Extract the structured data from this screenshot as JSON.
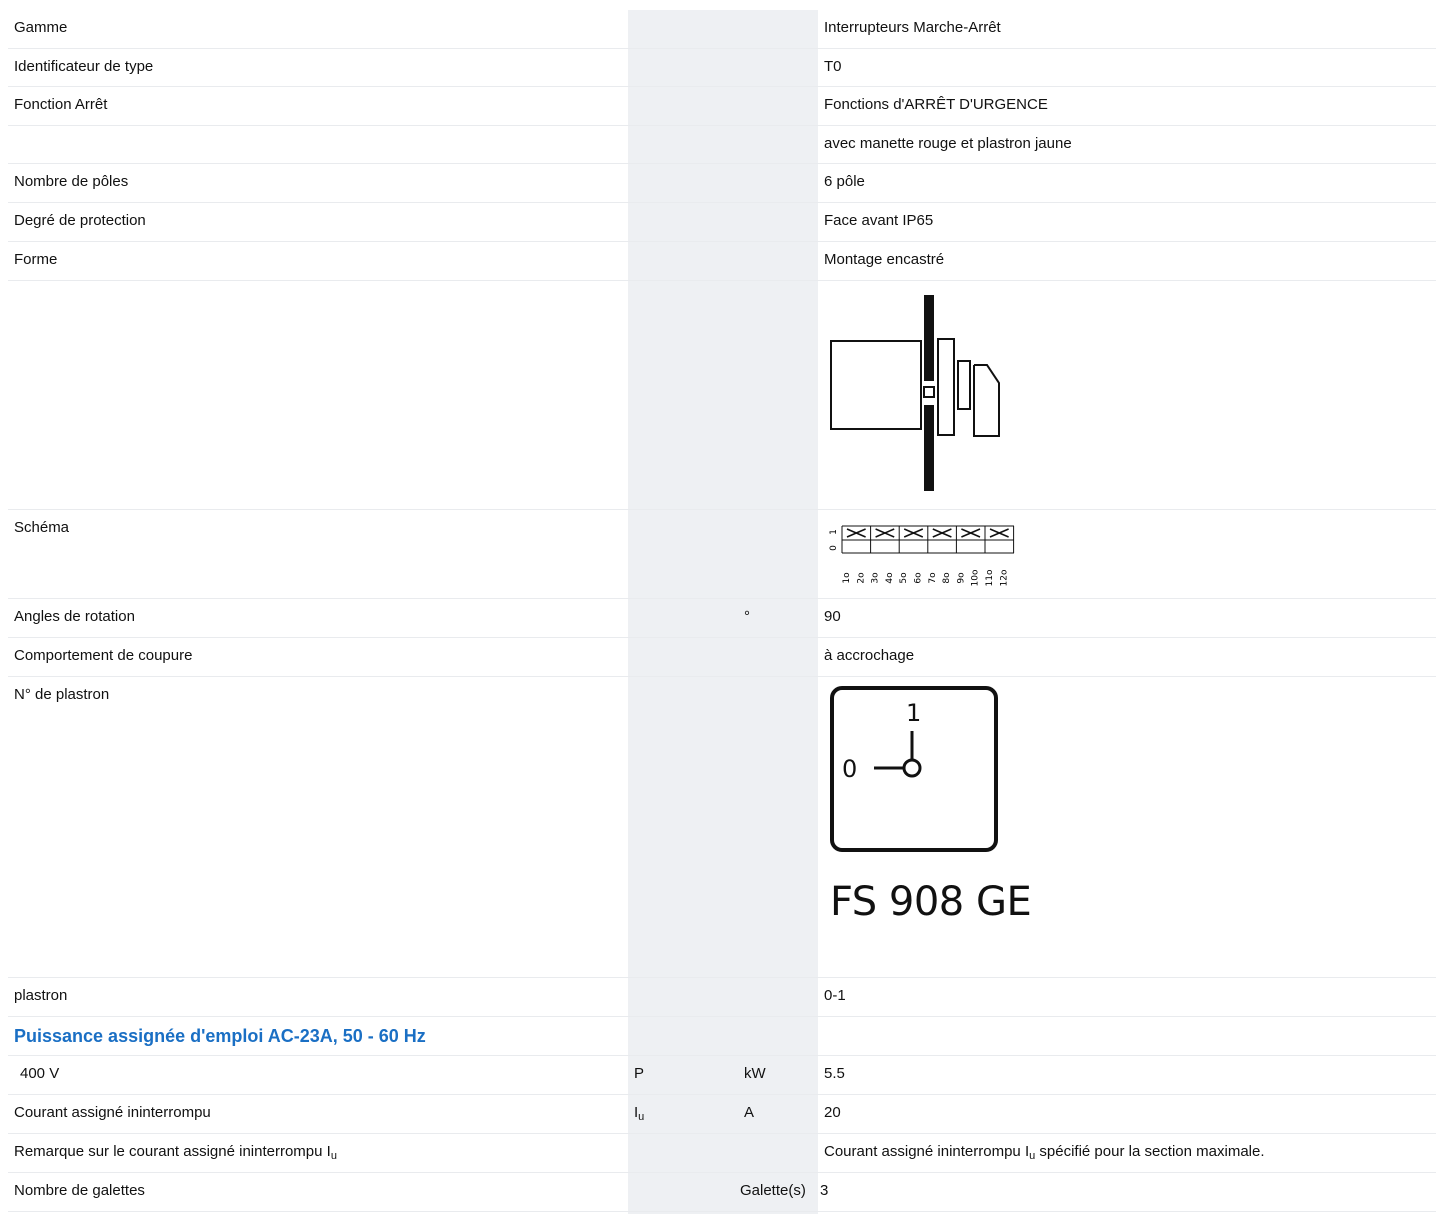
{
  "rows": [
    {
      "label": "Gamme",
      "symbol": "",
      "unit": "",
      "value": "Interrupteurs Marche-Arrêt"
    },
    {
      "label": "Identificateur de type",
      "symbol": "",
      "unit": "",
      "value": "T0"
    },
    {
      "label": "Fonction Arrêt",
      "symbol": "",
      "unit": "",
      "value": "Fonctions d'ARRÊT D'URGENCE"
    },
    {
      "label": "",
      "symbol": "",
      "unit": "",
      "value": "avec manette rouge et plastron jaune"
    },
    {
      "label": "Nombre de pôles",
      "symbol": "",
      "unit": "",
      "value": "6 pôle"
    },
    {
      "label": "Degré de protection",
      "symbol": "",
      "unit": "",
      "value": "Face avant IP65"
    },
    {
      "label": "Forme",
      "symbol": "",
      "unit": "",
      "value": "Montage encastré"
    },
    {
      "label": "Schéma",
      "symbol": "",
      "unit": "",
      "value": ""
    },
    {
      "label": "Angles de rotation",
      "symbol": "",
      "unit": "°",
      "value": "90"
    },
    {
      "label": "Comportement de coupure",
      "symbol": "",
      "unit": "",
      "value": "à accrochage"
    },
    {
      "label": "N° de plastron",
      "symbol": "",
      "unit": "",
      "value": "FS 908 GE"
    },
    {
      "label": "plastron",
      "symbol": "",
      "unit": "",
      "value": "0-1"
    }
  ],
  "section_heading": "Puissance assignée d'emploi AC-23A, 50 - 60 Hz",
  "power_row": {
    "label": "400 V",
    "symbol": "P",
    "unit": "kW",
    "value": "5.5"
  },
  "current_row": {
    "label": "Courant assigné ininterrompu",
    "symbol": "I",
    "symbol_sub": "u",
    "unit": "A",
    "value": "20"
  },
  "remark_row": {
    "label": "Remarque sur le courant assigné ininterrompu I",
    "label_sub": "u",
    "value_pre": "Courant assigné ininterrompu I",
    "value_sub": "u",
    "value_post": " spécifié pour la section maximale."
  },
  "galettes_row": {
    "label": "Nombre de galettes",
    "unit": "Galette(s)",
    "value": "3"
  },
  "schema": {
    "positions": [
      "1",
      "0"
    ],
    "contacts": [
      "1o",
      "2o",
      "3o",
      "4o",
      "5o",
      "6o",
      "7o",
      "8o",
      "9o",
      "10o",
      "11o",
      "12o"
    ]
  },
  "plate": {
    "pos0": "0",
    "pos1": "1"
  },
  "colors": {
    "heading": "#1a6fc4",
    "gray_column": "#eef0f3",
    "row_border": "#e9ebee"
  }
}
